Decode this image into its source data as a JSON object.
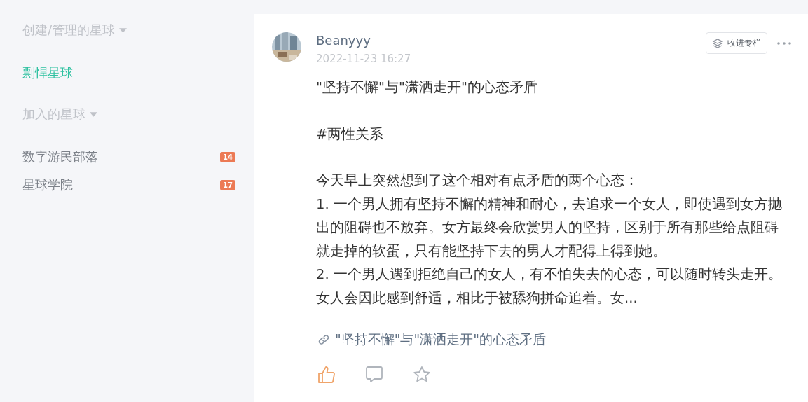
{
  "sidebar": {
    "sections": [
      {
        "title": "创建/管理的星球",
        "expanded": true,
        "items": [
          {
            "name": "剽悍星球",
            "selected": true
          }
        ]
      },
      {
        "title": "加入的星球",
        "expanded": true,
        "items": [
          {
            "name": "数字游民部落",
            "selected": false,
            "badge": "14"
          },
          {
            "name": "星球学院",
            "selected": false,
            "badge": "17"
          }
        ]
      }
    ]
  },
  "post": {
    "author": "Beanyyy",
    "time": "2022-11-23 16:27",
    "collect_button": "收进专栏",
    "paragraphs": [
      "\"坚持不懈\"与\"潇洒走开\"的心态矛盾",
      "#两性关系",
      "今天早上突然想到了这个相对有点矛盾的两个心态：\n1. 一个男人拥有坚持不懈的精神和耐心，去追求一个女人，即使遇到女方抛出的阻碍也不放弃。女方最终会欣赏男人的坚持，区别于所有那些给点阻碍就走掉的软蛋，只有能坚持下去的男人才配得上得到她。\n2. 一个男人遇到拒绝自己的女人，有不怕失去的心态，可以随时转头走开。女人会因此感到舒适，相比于被舔狗拼命追着。女..."
    ],
    "link": "\"坚持不懈\"与\"潇洒走开\"的心态矛盾",
    "liked": true
  }
}
